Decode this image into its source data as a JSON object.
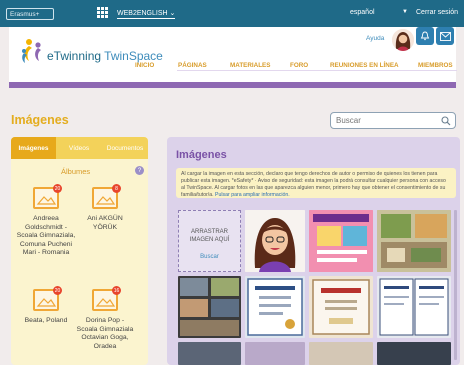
{
  "topbar": {
    "erasmus_label": "Erasmus+",
    "project": "WEB2ENGLISH",
    "language": "español",
    "logout": "Cerrar sesión"
  },
  "header": {
    "logo_part1": "eTwinning ",
    "logo_part2": "TwinSpace",
    "help": "Ayuda",
    "nav": [
      "INICIO",
      "PÁGINAS",
      "MATERIALES",
      "FORO",
      "REUNIONES EN LÍNEA",
      "MIEMBROS"
    ]
  },
  "main": {
    "title": "Imágenes",
    "search_placeholder": "Buscar"
  },
  "left_panel": {
    "tabs": [
      "Imágenes",
      "Vídeos",
      "Documentos"
    ],
    "albums_title": "Álbumes",
    "help_mark": "?",
    "albums": [
      {
        "name": "Andreea Goldschmidt - Scoala Gimnaziala, Comuna Pucheni Mari - Romania",
        "badge": "20"
      },
      {
        "name": "Ani AKGÜN YÖRÜK",
        "badge": "8"
      },
      {
        "name": "Beata, Poland",
        "badge": "20"
      },
      {
        "name": "Dorina Pop - Scoala Gimnaziala Octavian Goga, Oradea",
        "badge": "16"
      }
    ]
  },
  "right_panel": {
    "title": "Imágenes",
    "notice": "Al cargar la imagen en esta sección, declaro que tengo derechos de autor o permiso de quienes los tienen para publicar esta imagen. *eSafety* · Aviso de seguridad: esta imagen la podrá consultar cualquier persona con acceso al TwinSpace. Al cargar fotos en las que aparezca alguien menor, primero hay que obtener el consentimiento de su familia/tutor/a.",
    "notice_link": "Pulsar para ampliar información.",
    "drop_label": "ARRASTRAR IMAGEN AQUÍ",
    "drop_button": "Buscar"
  },
  "colors": {
    "topbar": "#1f6a88",
    "accent_purple": "#8e68b2",
    "accent_yellow": "#e4ad1f",
    "link_blue": "#3e8cbb"
  }
}
